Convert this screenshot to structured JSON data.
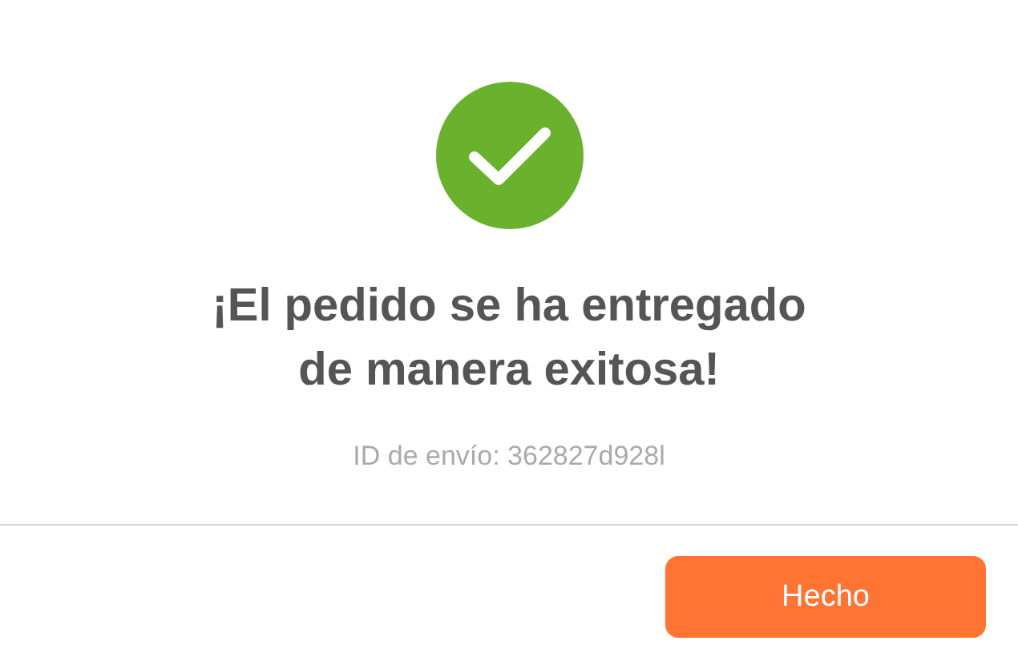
{
  "dialog": {
    "title": "¡El pedido se ha entregado\nde manera exitosa!",
    "shipment_id": "ID de envío: 362827d928l",
    "buttons": [
      {
        "label": "Hecho",
        "kind": "primary"
      }
    ]
  }
}
